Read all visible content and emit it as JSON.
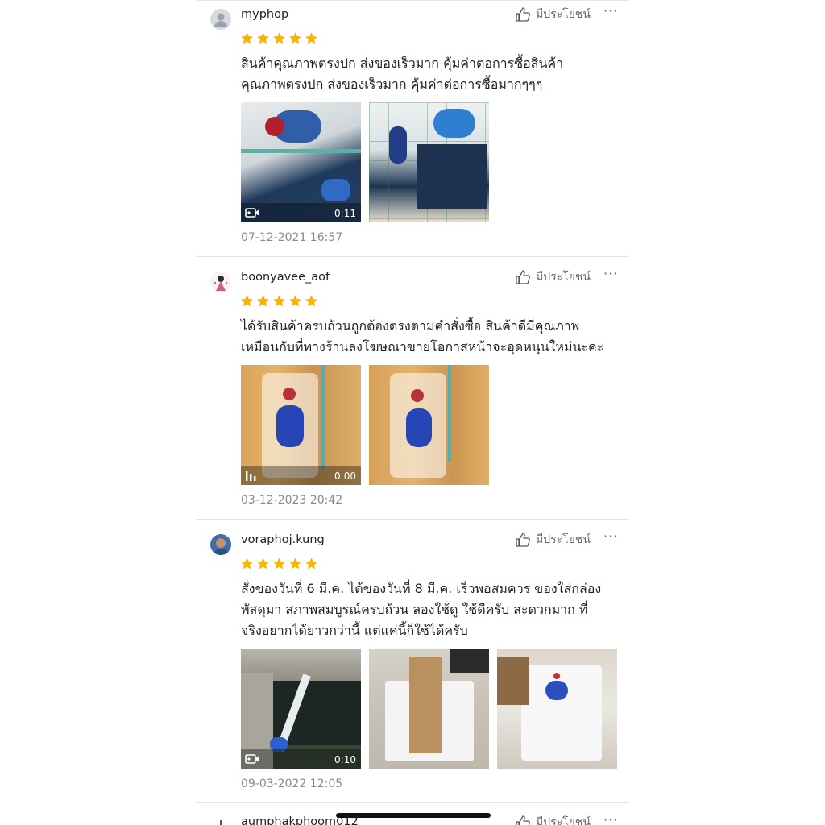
{
  "helpful_label": "มีประโยชน์",
  "more_label": "···",
  "star_color": "#f7b500",
  "reviews": [
    {
      "username": "myphop",
      "rating": 5,
      "text": "สินค้าคุณภาพตรงปก ส่งของเร็วมาก คุ้มค่าต่อการซื้อสินค้า\nคุณภาพตรงปก ส่งของเร็วมาก คุ้มค่าต่อการซื้อมากๆๆๆ",
      "video_duration": "0:11",
      "date": "07-12-2021 16:57"
    },
    {
      "username": "boonyavee_aof",
      "rating": 5,
      "text": "ได้รับสินค้าครบถ้วนถูกต้องตรงตามคำสั่งซื้อ สินค้าดีมีคุณภาพ\nเหมือนกับที่ทางร้านลงโฆษณาขายโอกาสหน้าจะอุดหนุนใหม่นะคะ",
      "video_duration": "0:00",
      "date": "03-12-2023 20:42"
    },
    {
      "username": "voraphoj.kung",
      "rating": 5,
      "text": "สั่งของวันที่ 6 มี.ค. ได้ของวันที่ 8 มี.ค. เร็วพอสมควร ของใส่กล่อง\nพัสดุมา สภาพสมบูรณ์ครบถ้วน ลองใช้ดู ใช้ดีครับ สะดวกมาก ที่\nจริงอยากได้ยาวกว่านี้ แต่แค่นี้ก็ใช้ได้ครับ",
      "video_duration": "0:10",
      "date": "09-03-2022 12:05"
    },
    {
      "username": "aumphakphoom012"
    }
  ]
}
